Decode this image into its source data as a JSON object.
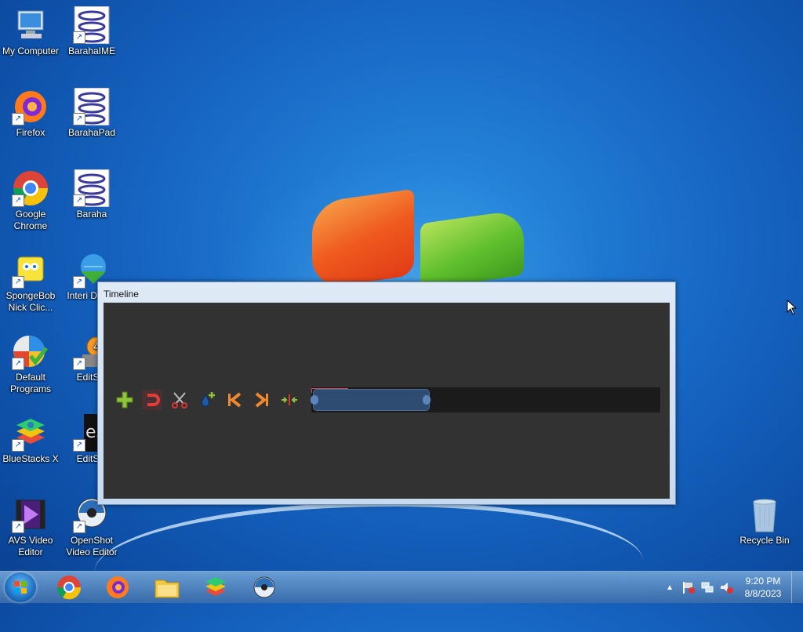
{
  "desktop": {
    "icons": [
      {
        "label": "My Computer",
        "icon": "computer-icon"
      },
      {
        "label": "BarahaIME",
        "icon": "baraha-icon"
      },
      {
        "label": "Firefox",
        "icon": "firefox-icon"
      },
      {
        "label": "BarahaPad",
        "icon": "baraha-icon"
      },
      {
        "label": "Google Chrome",
        "icon": "chrome-icon"
      },
      {
        "label": "Baraha",
        "icon": "baraha-icon"
      },
      {
        "label": "SpongeBob Nick Clic...",
        "icon": "spongebob-icon"
      },
      {
        "label": "Interi Downl",
        "icon": "internet-download-manager-icon"
      },
      {
        "label": "Default Programs",
        "icon": "default-programs-icon"
      },
      {
        "label": "EditStu",
        "icon": "editstudio-icon"
      },
      {
        "label": "BlueStacks X",
        "icon": "bluestacks-icon"
      },
      {
        "label": "EditStu",
        "icon": "editstudio-icon"
      },
      {
        "label": "AVS Video Editor",
        "icon": "avs-video-editor-icon"
      },
      {
        "label": "OpenShot Video Editor",
        "icon": "openshot-icon"
      },
      {
        "label": "Recycle Bin",
        "icon": "recycle-bin-icon"
      }
    ]
  },
  "window": {
    "title": "Timeline",
    "toolbar": [
      "add-track",
      "snapping",
      "razor",
      "add-marker",
      "previous-marker",
      "next-marker",
      "center-playhead"
    ],
    "zoom_range": {
      "start": 0.0,
      "end": 0.33
    }
  },
  "taskbar": {
    "apps": [
      "chrome-icon",
      "firefox-icon",
      "file-explorer-icon",
      "bluestacks-icon",
      "openshot-icon"
    ],
    "clock": {
      "time": "9:20 PM",
      "date": "8/8/2023"
    }
  },
  "colors": {
    "window_bg": "#323232",
    "track_bg": "#1b1b1b",
    "zoom_range": "#2e4c72"
  }
}
